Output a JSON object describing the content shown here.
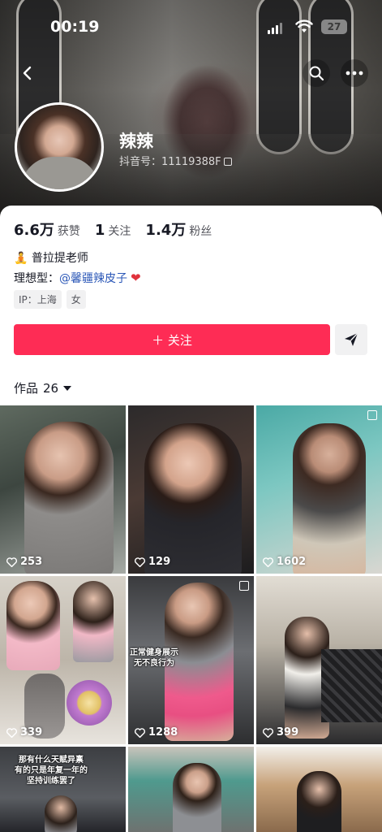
{
  "status_bar": {
    "time": "00:19",
    "battery": "27"
  },
  "profile": {
    "name": "辣辣",
    "douyin_id": "抖音号：11119388F",
    "stats": [
      {
        "value": "6.6万",
        "label": "获赞"
      },
      {
        "value": "1",
        "label": "关注"
      },
      {
        "value": "1.4万",
        "label": "粉丝"
      }
    ],
    "bio_line1": "🧘 普拉提老师",
    "bio_line2_prefix": "理想型：",
    "bio_mention": "@馨疆辣皮子",
    "tags": [
      "IP：上海",
      "女"
    ]
  },
  "actions": {
    "follow_label": "＋ 关注"
  },
  "works": {
    "label": "作品",
    "count": "26"
  },
  "videos": [
    {
      "likes": "253",
      "overlay": ""
    },
    {
      "likes": "129",
      "overlay": ""
    },
    {
      "likes": "1602",
      "overlay": ""
    },
    {
      "likes": "339",
      "overlay": ""
    },
    {
      "likes": "1288",
      "overlay": "正常健身展示\n无不良行为"
    },
    {
      "likes": "399",
      "overlay": ""
    },
    {
      "likes": "",
      "overlay": "那有什么天赋异禀\n有的只是年复一年的\n坚持训练罢了"
    },
    {
      "likes": "",
      "overlay": ""
    },
    {
      "likes": "",
      "overlay": ""
    }
  ],
  "colors": {
    "accent": "#fe2c55",
    "mention": "#2d59b8"
  }
}
